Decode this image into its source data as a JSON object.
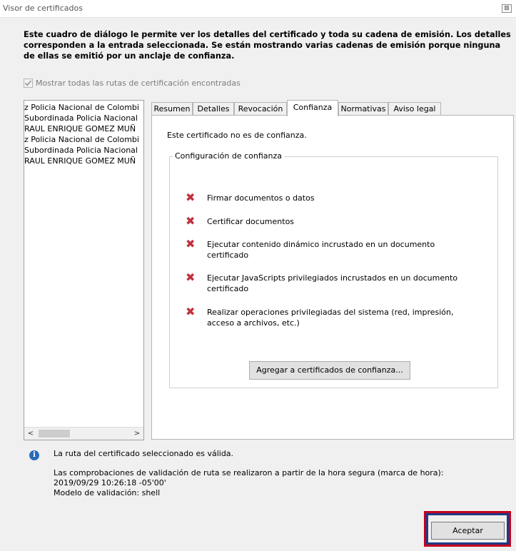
{
  "window": {
    "title": "Visor de certificados",
    "close_glyph": "⊠"
  },
  "intro_text": "Este cuadro de diálogo le permite ver los detalles del certificado y toda su cadena de emisión. Los detalles corresponden a la entrada seleccionada. Se están mostrando varias cadenas de emisión porque ninguna de ellas se emitió por un anclaje de confianza.",
  "show_all_paths": {
    "label": "Mostrar todas las rutas de certificación encontradas",
    "checked": true,
    "enabled": false
  },
  "cert_tree": {
    "items": [
      "z Policia Nacional de Colombi",
      "Subordinada Policia Nacional",
      "RAUL ENRIQUE GOMEZ MUÑ",
      "z Policia Nacional de Colombi",
      "Subordinada Policia Nacional",
      "RAUL ENRIQUE GOMEZ MUÑ"
    ],
    "scroll_left": "<",
    "scroll_right": ">"
  },
  "tabs": [
    {
      "label": "Resumen",
      "active": false
    },
    {
      "label": "Detalles",
      "active": false
    },
    {
      "label": "Revocación",
      "active": false
    },
    {
      "label": "Confianza",
      "active": true
    },
    {
      "label": "Normativas",
      "active": false
    },
    {
      "label": "Aviso legal",
      "active": false
    }
  ],
  "trust": {
    "status_text": "Este certificado no es de confianza.",
    "group_title": "Configuración de confianza",
    "permissions": [
      {
        "text": "Firmar documentos o datos",
        "allowed": false
      },
      {
        "text": "Certificar documentos",
        "allowed": false
      },
      {
        "text": "Ejecutar contenido dinámico incrustado en un documento certificado",
        "allowed": false
      },
      {
        "text": "Ejecutar JavaScripts privilegiados incrustados en un documento certificado",
        "allowed": false
      },
      {
        "text": "Realizar operaciones privilegiadas del sistema (red, impresión, acceso a archivos, etc.)",
        "allowed": false
      }
    ],
    "denied_glyph": "✖",
    "add_button": "Agregar a certificados de confianza..."
  },
  "info": {
    "icon": "info-icon",
    "icon_glyph": "i",
    "valid_text": "La ruta del certificado seleccionado es válida.",
    "validation_line1": "Las comprobaciones de validación de ruta se realizaron a partir de la hora segura (marca de hora):",
    "validation_line2": "2019/09/29 10:26:18 -05'00'",
    "validation_line3": "Modelo de validación: shell"
  },
  "footer": {
    "accept_button": "Aceptar"
  },
  "colors": {
    "denied_red": "#c0303e",
    "info_blue": "#2a6bb8",
    "highlight_red": "#c4001d",
    "highlight_blue": "#1f3a85"
  }
}
